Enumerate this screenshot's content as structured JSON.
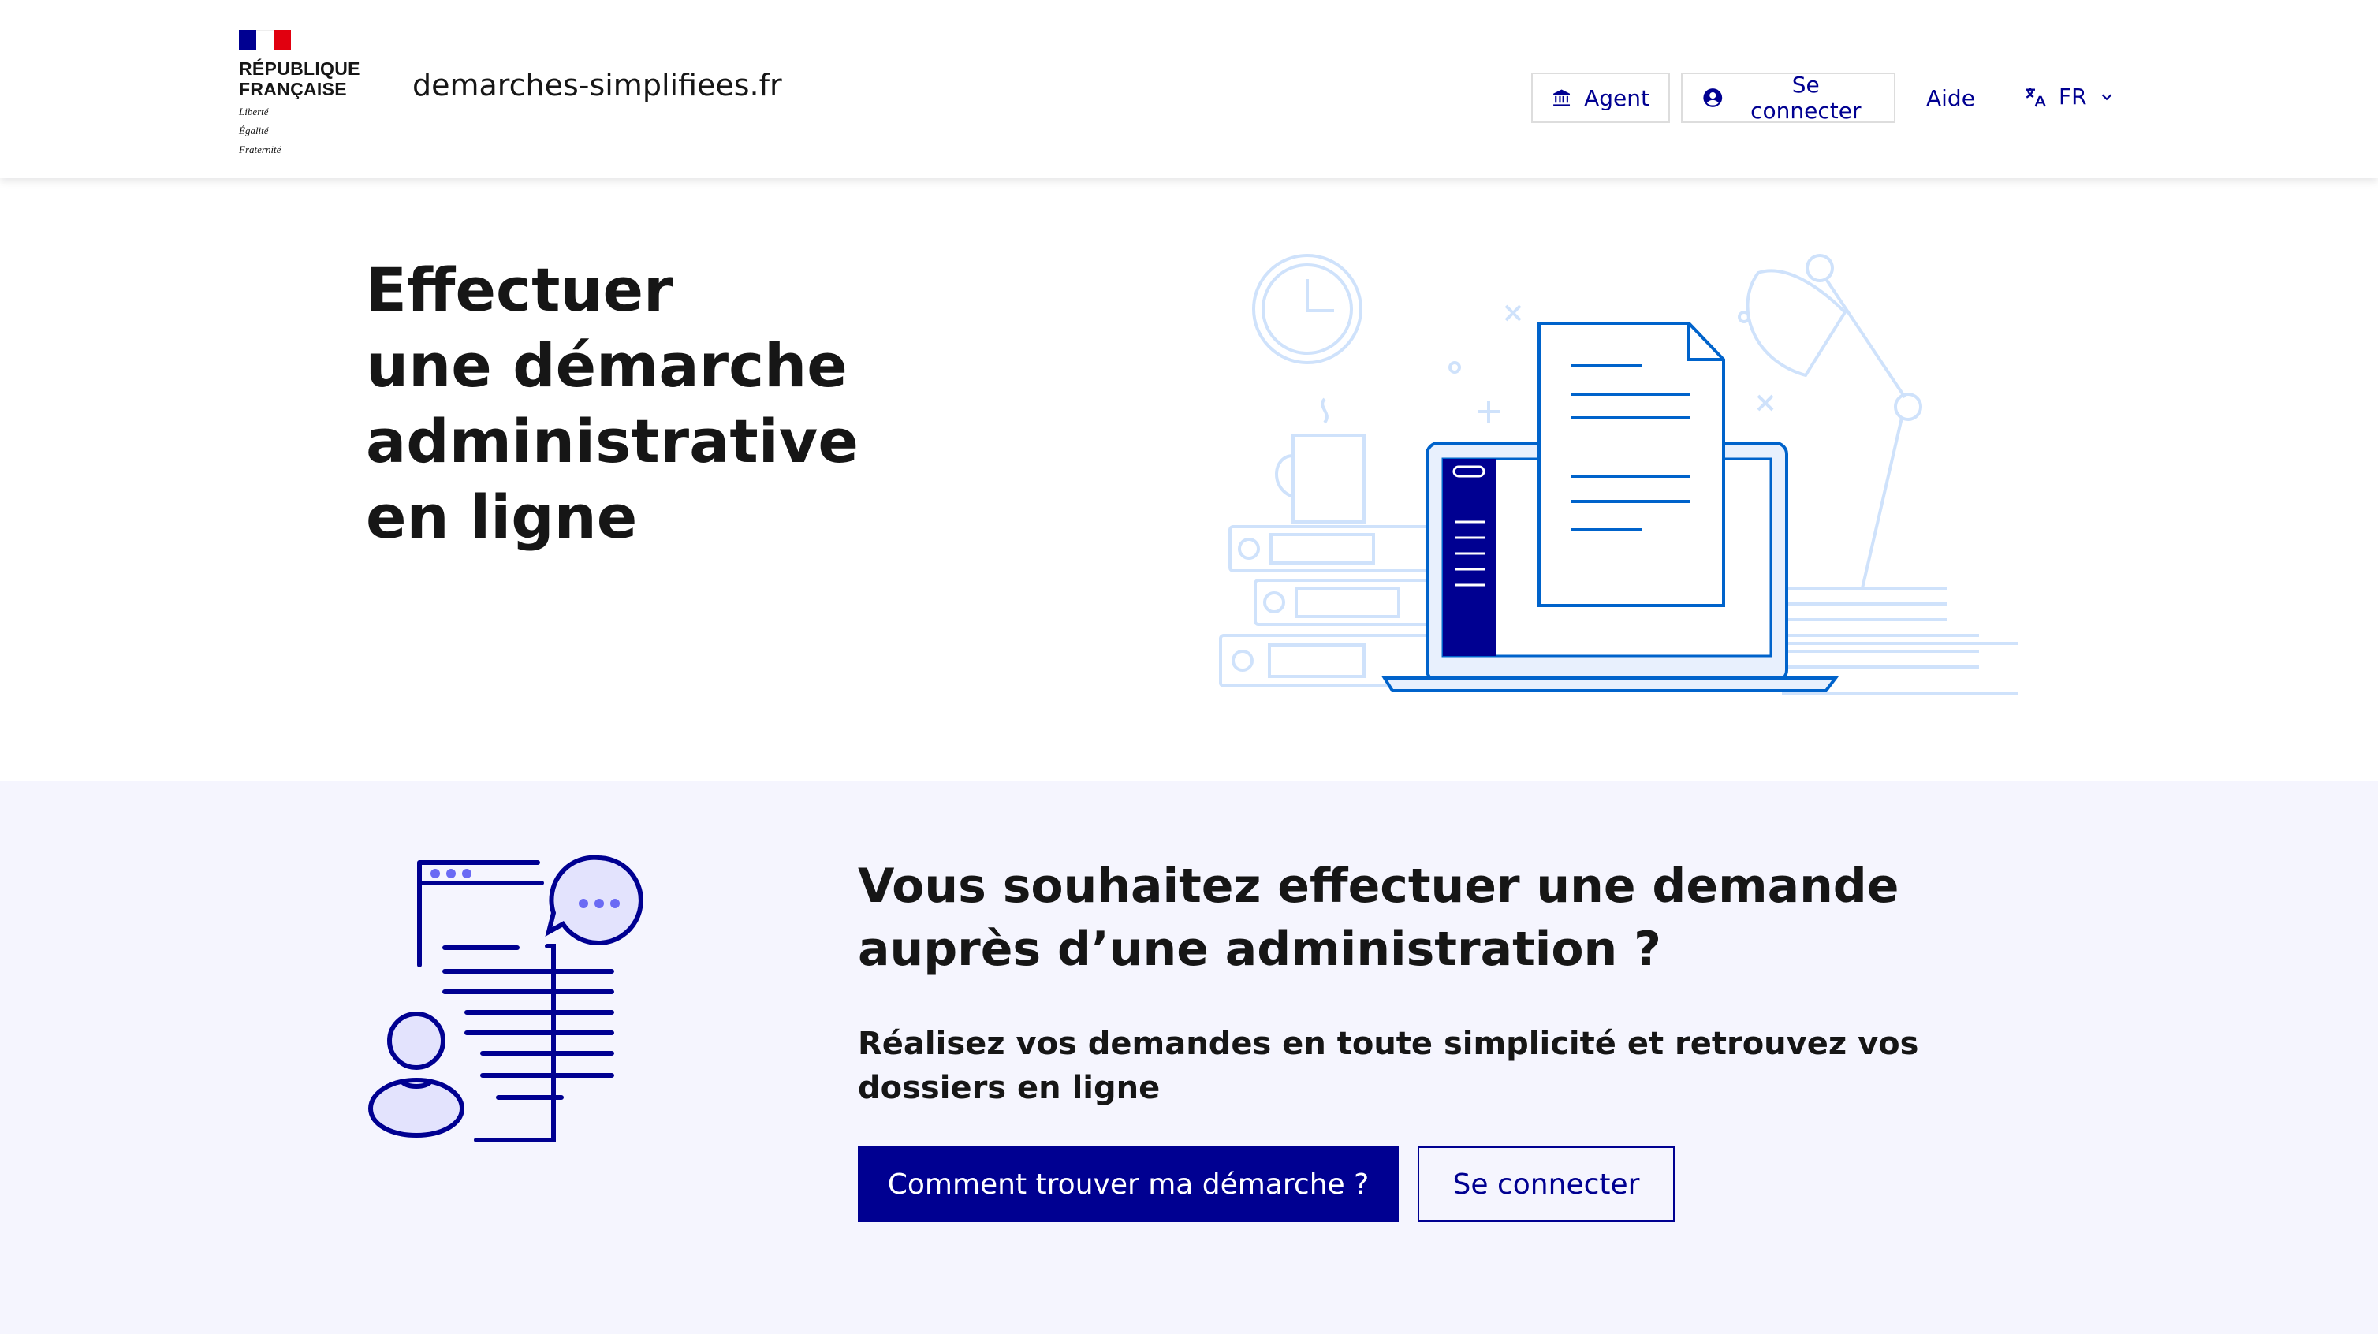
{
  "header": {
    "rf_line1": "RÉPUBLIQUE",
    "rf_line2": "FRANÇAISE",
    "motto_line1": "Liberté",
    "motto_line2": "Égalité",
    "motto_line3": "Fraternité",
    "site_name": "demarches-simplifiees.fr",
    "agent_label": "Agent",
    "connect_label": "Se connecter",
    "help_label": "Aide",
    "lang_label": "FR"
  },
  "hero": {
    "title_line1": "Effectuer",
    "title_line2": "une démarche",
    "title_line3": "administrative",
    "title_line4": "en ligne"
  },
  "lower": {
    "title": "Vous souhaitez effectuer une demande auprès d’une administration ?",
    "subtitle": "Réalisez vos demandes en toute simplicité et retrouvez vos dossiers en ligne",
    "primary_button": "Comment trouver ma démarche ?",
    "secondary_button": "Se connecter"
  },
  "colors": {
    "brand_blue": "#000091",
    "marianne_red": "#e1000f",
    "section_bg": "#f5f5fe",
    "illustration_blue": "#0063cb",
    "illustration_light": "#cfe2fb"
  },
  "icons": {
    "agent": "bank-icon",
    "connect": "account-circle-icon",
    "lang": "translate-icon",
    "lang_chevron": "chevron-down-icon"
  }
}
